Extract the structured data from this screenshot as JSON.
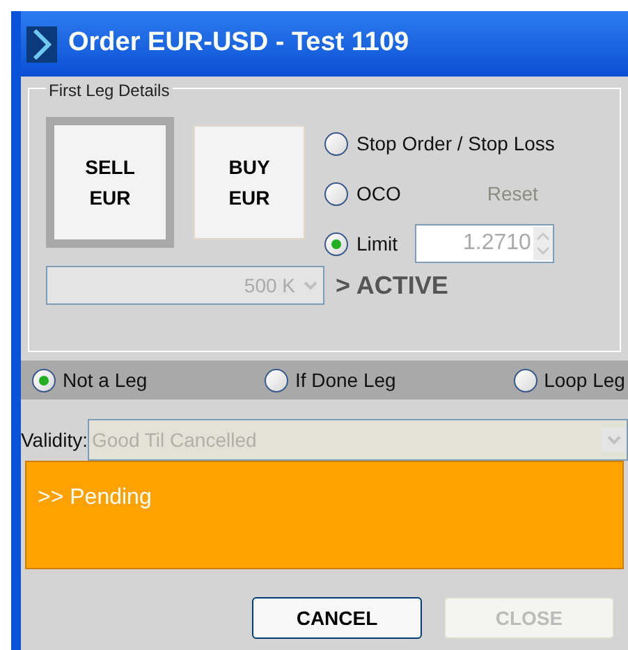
{
  "window": {
    "title": "Order EUR-USD -  Test 1109"
  },
  "first_leg": {
    "title": "First Leg Details",
    "sides": [
      {
        "lines": [
          "SELL",
          "EUR"
        ],
        "selected": true
      },
      {
        "lines": [
          "BUY",
          "EUR"
        ],
        "selected": false
      }
    ],
    "order_types": [
      {
        "label": "Stop Order / Stop Loss",
        "selected": false
      },
      {
        "label": "OCO",
        "selected": false
      },
      {
        "label": "Limit",
        "selected": true
      }
    ],
    "reset": {
      "label": "Reset",
      "disabled": true
    },
    "limit_price": {
      "value": "1.2710",
      "disabled": true
    },
    "amount": {
      "value": "500 K",
      "disabled": true
    },
    "status": "> ACTIVE"
  },
  "legs": [
    {
      "label": "Not a Leg",
      "selected": true
    },
    {
      "label": "If Done Leg",
      "selected": false
    },
    {
      "label": "Loop Leg",
      "selected": false
    }
  ],
  "validity": {
    "label": "Validity:",
    "value": "Good Til Cancelled",
    "disabled": true
  },
  "message": ">> Pending",
  "buttons": [
    {
      "label": "CANCEL",
      "disabled": false
    },
    {
      "label": "CLOSE",
      "disabled": true
    }
  ]
}
